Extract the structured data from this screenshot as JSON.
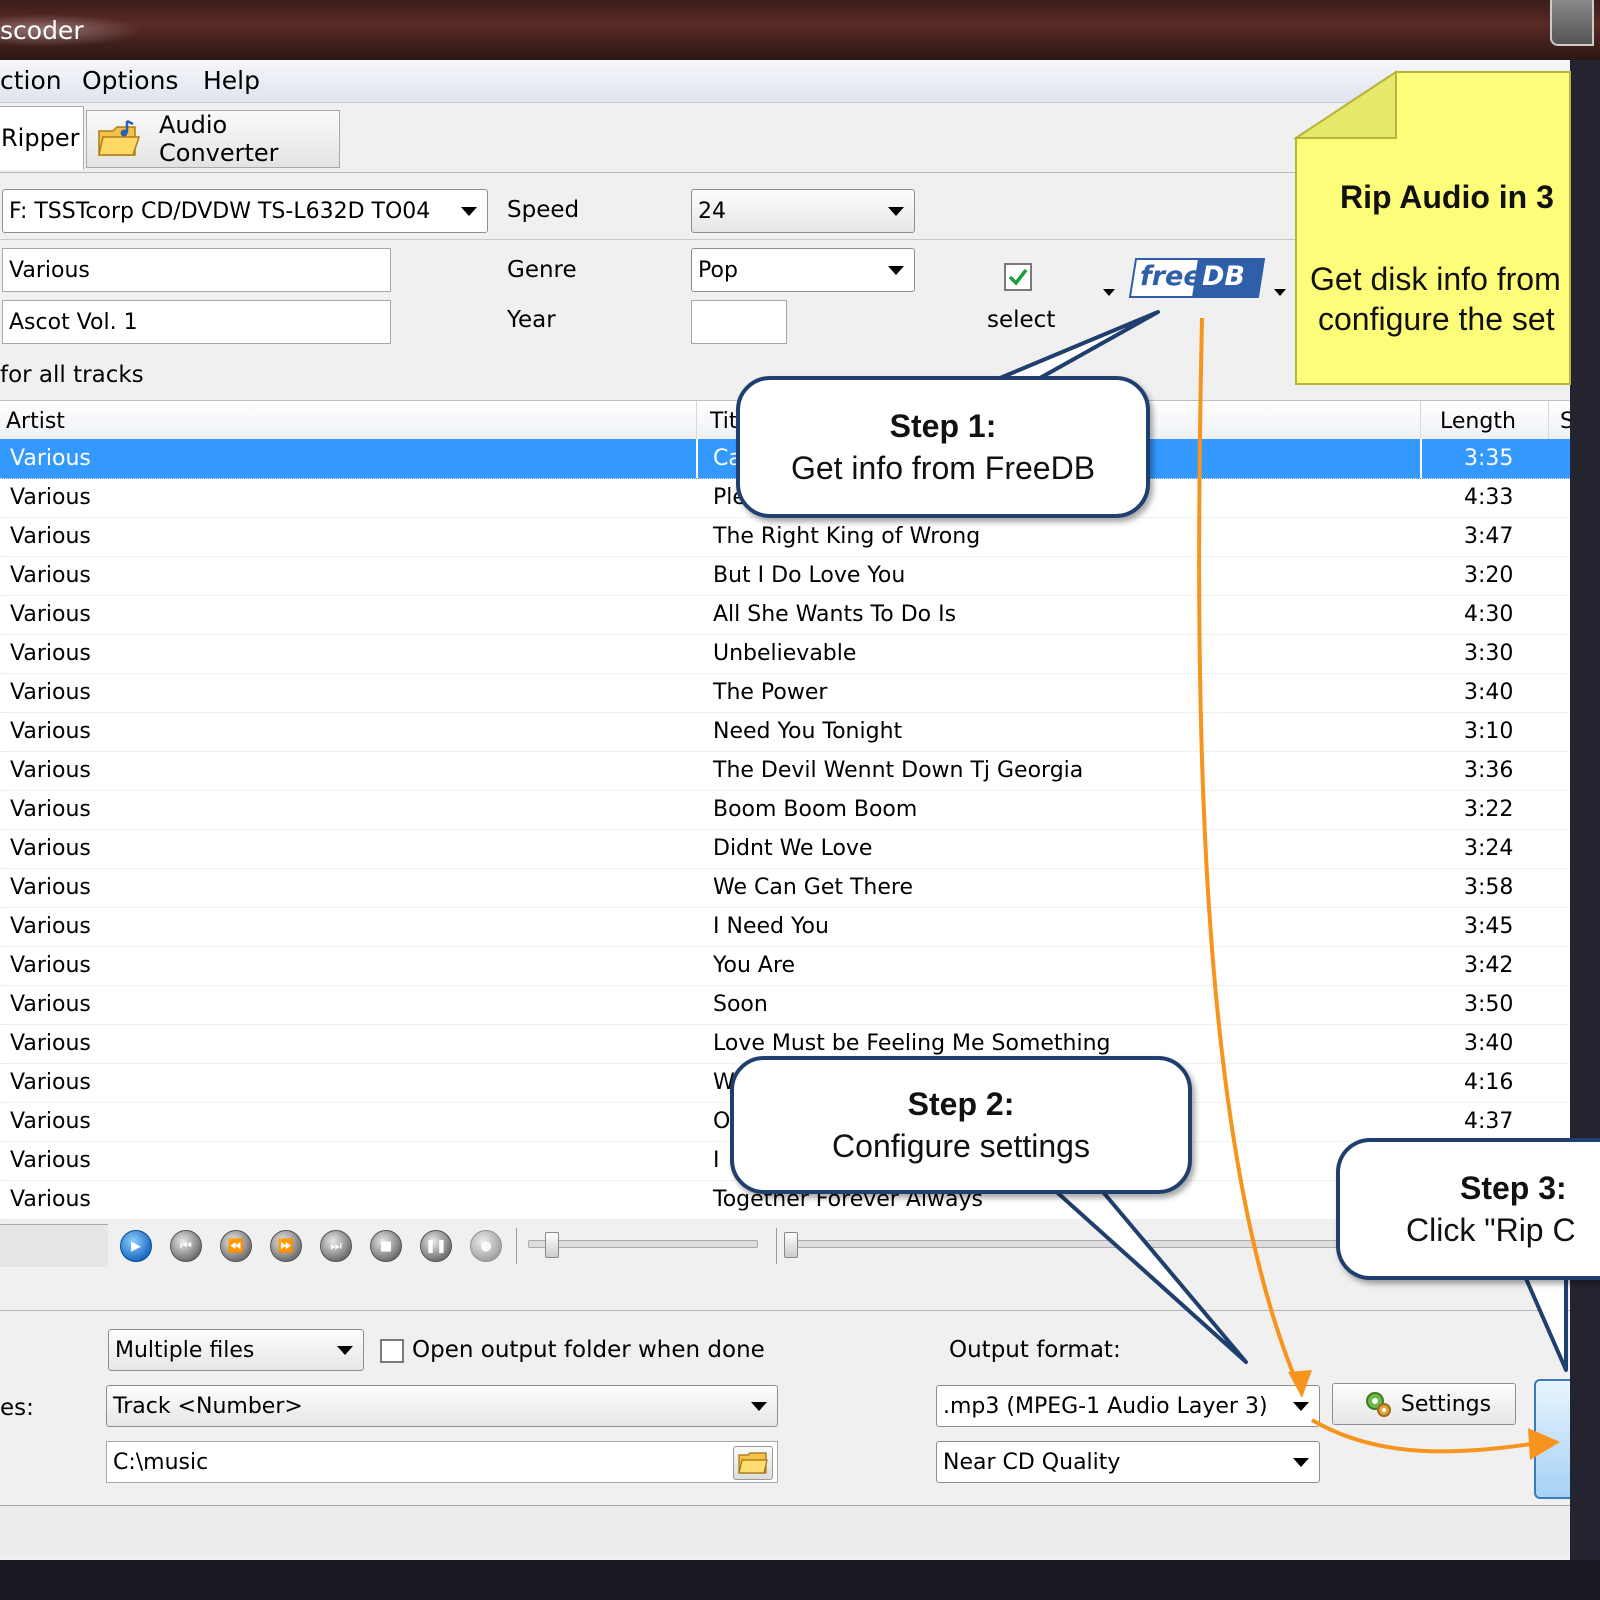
{
  "window": {
    "title": "scoder"
  },
  "menu": [
    "ction",
    "Options",
    "Help"
  ],
  "tabs": [
    {
      "label": "Ripper",
      "active": true
    },
    {
      "label": "Audio Converter",
      "active": false
    }
  ],
  "drive": {
    "value": "F: TSSTcorp CD/DVDW TS-L632D TO04"
  },
  "speed": {
    "label": "Speed",
    "value": "24"
  },
  "artist_field": {
    "value": "Various"
  },
  "album_field": {
    "value": "Ascot Vol. 1"
  },
  "genre": {
    "label": "Genre",
    "value": "Pop"
  },
  "year": {
    "label": "Year",
    "value": ""
  },
  "select_label": "select",
  "select_checked": true,
  "freedb_logo": {
    "left": "free",
    "right": "DB"
  },
  "for_all_tracks": "for all tracks",
  "columns": {
    "artist": "Artist",
    "title": "Tit",
    "length": "Length",
    "extra": "S"
  },
  "tracks": [
    {
      "artist": "Various",
      "title": "Ca",
      "length": "3:35",
      "selected": true
    },
    {
      "artist": "Various",
      "title": "Ple",
      "length": "4:33"
    },
    {
      "artist": "Various",
      "title": "The Right King of Wrong",
      "length": "3:47"
    },
    {
      "artist": "Various",
      "title": "But I Do Love You",
      "length": "3:20"
    },
    {
      "artist": "Various",
      "title": "All She Wants To Do Is",
      "length": "4:30"
    },
    {
      "artist": "Various",
      "title": "Unbelievable",
      "length": "3:30"
    },
    {
      "artist": "Various",
      "title": "The Power",
      "length": "3:40"
    },
    {
      "artist": "Various",
      "title": "Need You Tonight",
      "length": "3:10"
    },
    {
      "artist": "Various",
      "title": "The Devil Wennt Down Tj Georgia",
      "length": "3:36"
    },
    {
      "artist": "Various",
      "title": "Boom Boom Boom",
      "length": "3:22"
    },
    {
      "artist": "Various",
      "title": "Didnt We Love",
      "length": "3:24"
    },
    {
      "artist": "Various",
      "title": "We Can Get There",
      "length": "3:58"
    },
    {
      "artist": "Various",
      "title": "I Need You",
      "length": "3:45"
    },
    {
      "artist": "Various",
      "title": "You Are",
      "length": "3:42"
    },
    {
      "artist": "Various",
      "title": "Soon",
      "length": "3:50"
    },
    {
      "artist": "Various",
      "title": "Love Must be Feeling Me Something",
      "length": "3:40"
    },
    {
      "artist": "Various",
      "title": "W",
      "length": "4:16"
    },
    {
      "artist": "Various",
      "title": "O",
      "length": "4:37"
    },
    {
      "artist": "Various",
      "title": "I",
      "length": ""
    },
    {
      "artist": "Various",
      "title": "Together Forever Always",
      "length": ""
    }
  ],
  "output": {
    "files_mode": "Multiple files",
    "open_folder_label": "Open output folder when done",
    "open_folder_checked": false,
    "names_label": "es:",
    "name_pattern": "Track <Number>",
    "folder": "C:\\music",
    "format_label": "Output format:",
    "format": ".mp3 (MPEG-1 Audio Layer 3)",
    "quality": "Near CD Quality",
    "settings_label": "Settings"
  },
  "note": {
    "title": "Rip Audio in 3",
    "line1": "Get disk info from",
    "line2": "configure the set"
  },
  "callouts": {
    "step1": {
      "title": "Step 1:",
      "text": "Get info from FreeDB"
    },
    "step2": {
      "title": "Step 2:",
      "text": "Configure settings"
    },
    "step3": {
      "title": "Step 3:",
      "text": "Click \"Rip C"
    }
  },
  "colors": {
    "selection": "#3399ff",
    "note": "#fdfd7a",
    "callout_border": "#1f3f6e",
    "arrow": "#f7941d"
  }
}
